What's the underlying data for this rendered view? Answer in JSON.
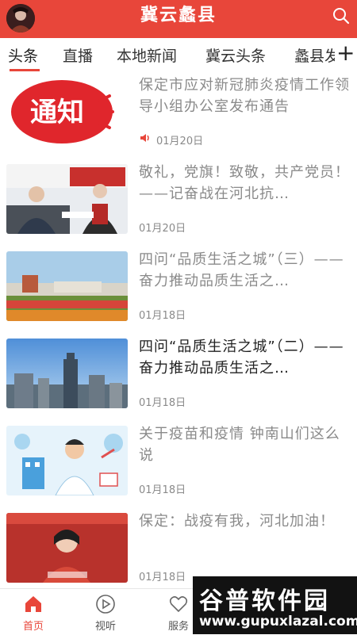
{
  "header": {
    "title": "冀云蠡县",
    "avatar_icon": "avatar",
    "search_icon": "search-icon",
    "color": "#e8463a"
  },
  "tabs": {
    "items": [
      {
        "label": "头条"
      },
      {
        "label": "直播"
      },
      {
        "label": "本地新闻"
      },
      {
        "label": "冀云头条"
      },
      {
        "label": "蠡县发"
      }
    ],
    "active_index": 0,
    "add_label": "+"
  },
  "news": [
    {
      "title": "保定市应对新冠肺炎疫情工作领导小组办公室发布通告",
      "date": "01月20日",
      "has_audio": true,
      "thumb_text": "通知"
    },
    {
      "title": "敬礼，党旗！致敬，共产党员！——记奋战在河北抗…",
      "date": "01月20日",
      "has_audio": false
    },
    {
      "title": "四问“品质生活之城”（三）——奋力推动品质生活之…",
      "date": "01月18日",
      "has_audio": false
    },
    {
      "title": "四问“品质生活之城”（二）——奋力推动品质生活之…",
      "date": "01月18日",
      "has_audio": false
    },
    {
      "title": "关于疫苗和疫情 钟南山们这么说",
      "date": "01月18日",
      "has_audio": false
    },
    {
      "title": "保定：战疫有我，河北加油！",
      "date": "01月18日",
      "has_audio": false
    }
  ],
  "bottom_nav": [
    {
      "label": "首页",
      "icon": "home-icon",
      "active": true
    },
    {
      "label": "视听",
      "icon": "play-icon",
      "active": false
    },
    {
      "label": "服务",
      "icon": "heart-icon",
      "active": false
    }
  ],
  "watermark": {
    "main": "谷普软件园",
    "url": "www.gupuxlazal.com"
  }
}
